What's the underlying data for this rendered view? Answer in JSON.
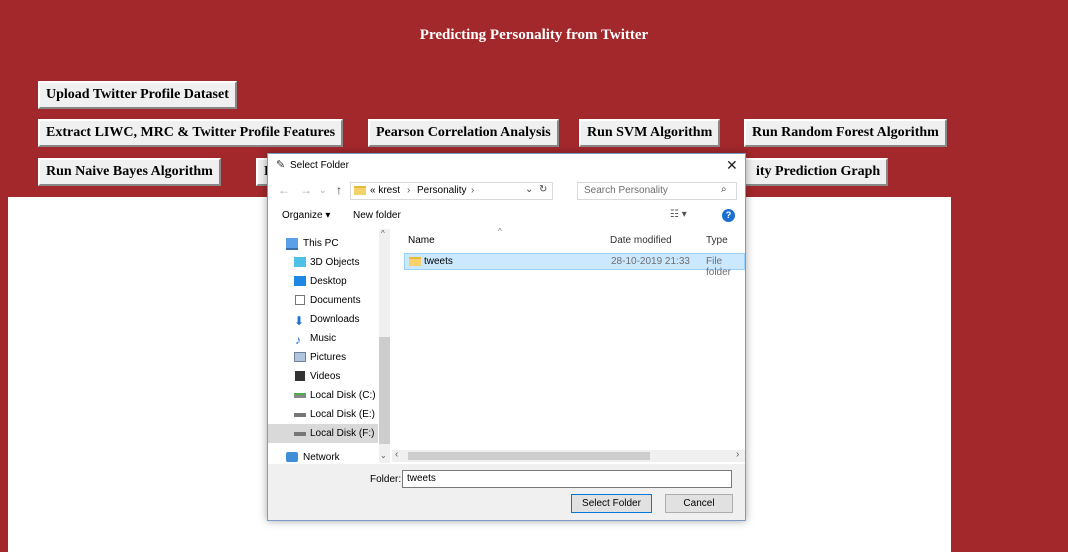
{
  "app": {
    "title": "Predicting Personality from Twitter",
    "buttons": {
      "upload": "Upload Twitter Profile Dataset",
      "extract": "Extract LIWC, MRC & Twitter Profile Features",
      "pearson": "Pearson Correlation Analysis",
      "svm": "Run SVM Algorithm",
      "rf": "Run Random Forest Algorithm",
      "nb": "Run Naive Bayes Algorithm",
      "hidden_left": "R",
      "graph_partial": "ity Prediction Graph"
    }
  },
  "dialog": {
    "title": "Select Folder",
    "close": "✕",
    "breadcrumb": [
      "« krest",
      "Personality"
    ],
    "search_placeholder": "Search Personality",
    "toolbar": {
      "organize": "Organize ▾",
      "new_folder": "New folder"
    },
    "tree": [
      {
        "label": "This PC",
        "icon": "pc-icon"
      },
      {
        "label": "3D Objects",
        "icon": "3d-objects-icon"
      },
      {
        "label": "Desktop",
        "icon": "desktop-icon"
      },
      {
        "label": "Documents",
        "icon": "documents-icon"
      },
      {
        "label": "Downloads",
        "icon": "downloads-icon"
      },
      {
        "label": "Music",
        "icon": "music-icon"
      },
      {
        "label": "Pictures",
        "icon": "pictures-icon"
      },
      {
        "label": "Videos",
        "icon": "videos-icon"
      },
      {
        "label": "Local Disk (C:)",
        "icon": "disk-icon"
      },
      {
        "label": "Local Disk (E:)",
        "icon": "disk-icon"
      },
      {
        "label": "Local Disk (F:)",
        "icon": "disk-icon"
      },
      {
        "label": "Network",
        "icon": "network-icon"
      }
    ],
    "columns": {
      "name": "Name",
      "date": "Date modified",
      "type": "Type"
    },
    "rows": [
      {
        "name": "tweets",
        "date": "28-10-2019 21:33",
        "type": "File folder"
      }
    ],
    "folder_label": "Folder:",
    "folder_value": "tweets",
    "select_button": "Select Folder",
    "cancel_button": "Cancel"
  }
}
